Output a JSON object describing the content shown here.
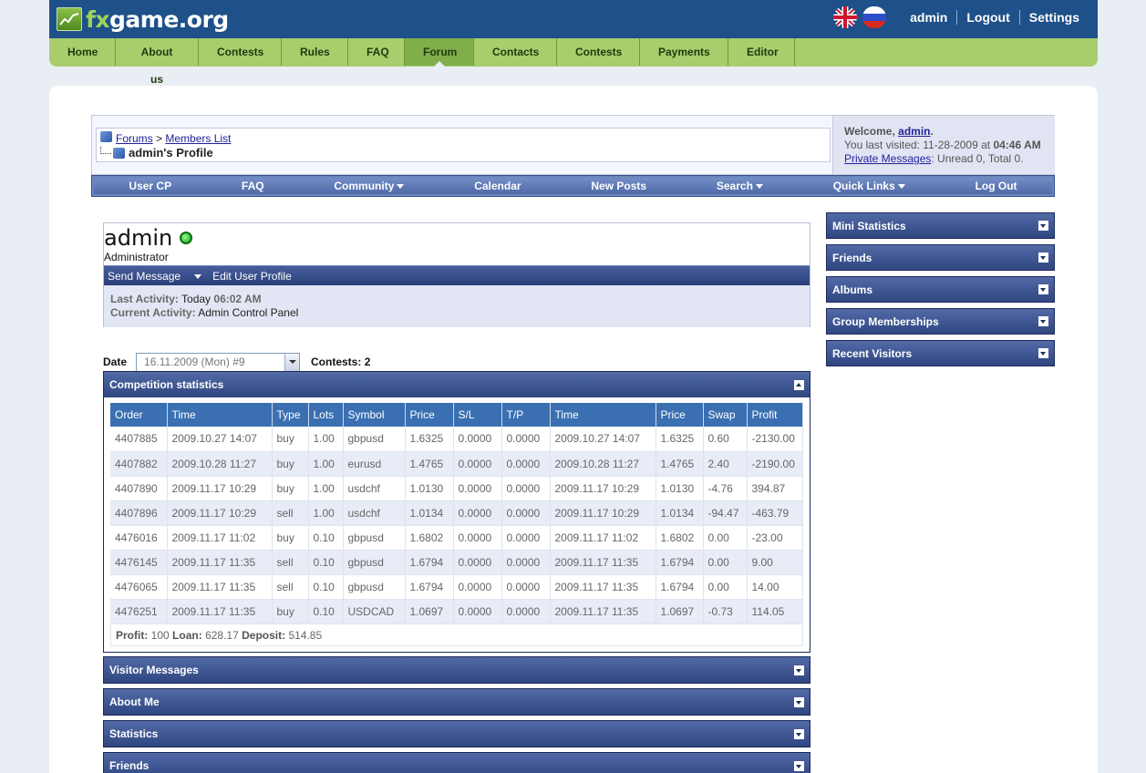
{
  "site": {
    "logo_fx": "fx",
    "logo_rest": "game.org",
    "user_link": "admin",
    "logout": "Logout",
    "settings": "Settings"
  },
  "mainnav": [
    "Home",
    "About us",
    "Contests",
    "Rules",
    "FAQ",
    "Forum",
    "Contacts",
    "Contests",
    "Payments",
    "Editor"
  ],
  "mainnav_active": "Forum",
  "breadcrumb": {
    "forums": "Forums",
    "sep": ">",
    "members": "Members List",
    "current": "admin's Profile"
  },
  "welcome": {
    "label": "Welcome,",
    "user": "admin",
    "dot": ".",
    "visited_label": "You last visited: 11-28-2009 at",
    "visited_time": "04:46 AM",
    "pm_link": "Private Messages",
    "pm_counts": ": Unread 0, Total 0."
  },
  "vbnav": [
    "User CP",
    "FAQ",
    "Community",
    "Calendar",
    "New Posts",
    "Search",
    "Quick Links",
    "Log Out"
  ],
  "profile": {
    "name": "admin",
    "role": "Administrator",
    "send_message": "Send Message",
    "edit_profile": "Edit User Profile",
    "last_activity_label": "Last Activity:",
    "last_activity_day": "Today",
    "last_activity_time": "06:02 AM",
    "current_activity_label": "Current Activity:",
    "current_activity": "Admin Control Panel"
  },
  "date_row": {
    "label": "Date",
    "selected": "16.11.2009 (Mon) #9",
    "contests_label": "Contests:",
    "contests_value": "2"
  },
  "competition": {
    "title": "Competition statistics",
    "columns": [
      "Order",
      "Time",
      "Type",
      "Lots",
      "Symbol",
      "Price",
      "S/L",
      "T/P",
      "Time",
      "Price",
      "Swap",
      "Profit"
    ],
    "rows": [
      [
        "4407885",
        "2009.10.27 14:07",
        "buy",
        "1.00",
        "gbpusd",
        "1.6325",
        "0.0000",
        "0.0000",
        "2009.10.27 14:07",
        "1.6325",
        "0.60",
        "-2130.00"
      ],
      [
        "4407882",
        "2009.10.28 11:27",
        "buy",
        "1.00",
        "eurusd",
        "1.4765",
        "0.0000",
        "0.0000",
        "2009.10.28 11:27",
        "1.4765",
        "2.40",
        "-2190.00"
      ],
      [
        "4407890",
        "2009.11.17 10:29",
        "buy",
        "1.00",
        "usdchf",
        "1.0130",
        "0.0000",
        "0.0000",
        "2009.11.17 10:29",
        "1.0130",
        "-4.76",
        "394.87"
      ],
      [
        "4407896",
        "2009.11.17 10:29",
        "sell",
        "1.00",
        "usdchf",
        "1.0134",
        "0.0000",
        "0.0000",
        "2009.11.17 10:29",
        "1.0134",
        "-94.47",
        "-463.79"
      ],
      [
        "4476016",
        "2009.11.17 11:02",
        "buy",
        "0.10",
        "gbpusd",
        "1.6802",
        "0.0000",
        "0.0000",
        "2009.11.17 11:02",
        "1.6802",
        "0.00",
        "-23.00"
      ],
      [
        "4476145",
        "2009.11.17 11:35",
        "sell",
        "0.10",
        "gbpusd",
        "1.6794",
        "0.0000",
        "0.0000",
        "2009.11.17 11:35",
        "1.6794",
        "0.00",
        "9.00"
      ],
      [
        "4476065",
        "2009.11.17 11:35",
        "sell",
        "0.10",
        "gbpusd",
        "1.6794",
        "0.0000",
        "0.0000",
        "2009.11.17 11:35",
        "1.6794",
        "0.00",
        "14.00"
      ],
      [
        "4476251",
        "2009.11.17 11:35",
        "buy",
        "0.10",
        "USDCAD",
        "1.0697",
        "0.0000",
        "0.0000",
        "2009.11.17 11:35",
        "1.0697",
        "-0.73",
        "114.05"
      ]
    ],
    "totals": {
      "profit_label": "Profit:",
      "profit": "100",
      "loan_label": "Loan:",
      "loan": "628.17",
      "deposit_label": "Deposit:",
      "deposit": "514.85"
    }
  },
  "collapsed_blocks": [
    "Visitor Messages",
    "About Me",
    "Statistics",
    "Friends"
  ],
  "sidebar": [
    "Mini Statistics",
    "Friends",
    "Albums",
    "Group Memberships",
    "Recent Visitors"
  ],
  "colors": {
    "top_bar": "#1e5089",
    "main_nav": "#a8cd6c",
    "block_header": "#2f4681",
    "table_header": "#3a70b2"
  }
}
